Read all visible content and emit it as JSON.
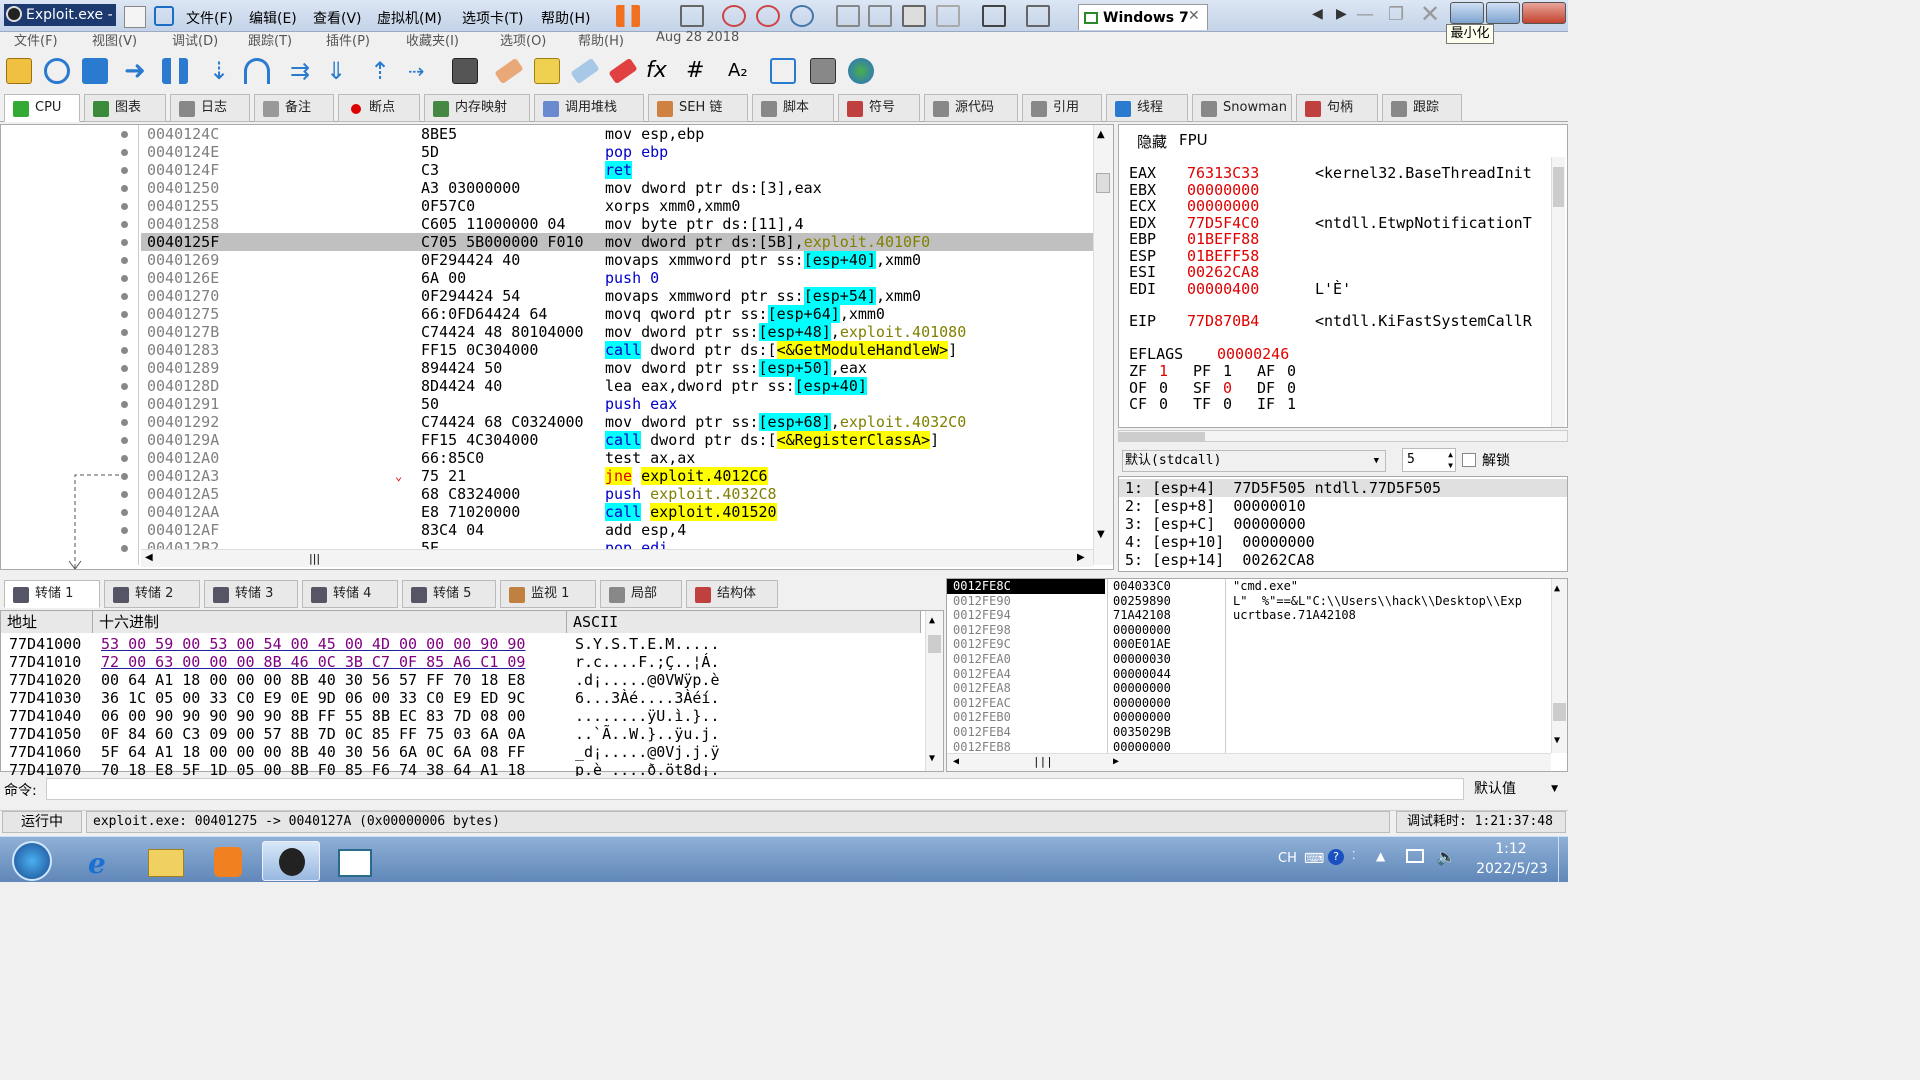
{
  "window": {
    "title": "Exploit.exe -",
    "vm_tab": "Windows 7",
    "tooltip": "最小化"
  },
  "host_menu": [
    "文件(F)",
    "编辑(E)",
    "查看(V)",
    "虚拟机(M)",
    "选项卡(T)",
    "帮助(H)"
  ],
  "app_menu": [
    "文件(F)",
    "视图(V)",
    "调试(D)",
    "跟踪(T)",
    "插件(P)",
    "收藏夹(I)",
    "选项(O)",
    "帮助(H)",
    "Aug 28 2018"
  ],
  "tabs": [
    "CPU",
    "图表",
    "日志",
    "备注",
    "断点",
    "内存映射",
    "调用堆栈",
    "SEH 链",
    "脚本",
    "符号",
    "源代码",
    "引用",
    "线程",
    "Snowman",
    "句柄",
    "跟踪"
  ],
  "disasm": [
    {
      "addr": "0040124C",
      "bytes": "8BE5",
      "ins": [
        [
          "mov esp,ebp",
          ""
        ]
      ]
    },
    {
      "addr": "0040124E",
      "bytes": "5D",
      "ins": [
        [
          "pop ebp",
          "blue"
        ]
      ]
    },
    {
      "addr": "0040124F",
      "bytes": "C3",
      "ins": [
        [
          "ret",
          "cyanblue"
        ]
      ]
    },
    {
      "addr": "00401250",
      "bytes": "A3 03000000",
      "ins": [
        [
          "mov dword ptr ",
          ""
        ],
        [
          "ds",
          ""
        ],
        [
          ":[3],eax",
          ""
        ]
      ]
    },
    {
      "addr": "00401255",
      "bytes": "0F57C0",
      "ins": [
        [
          "xorps xmm0,xmm0",
          ""
        ]
      ]
    },
    {
      "addr": "00401258",
      "bytes": "C605 11000000 04",
      "ins": [
        [
          "mov byte ptr ",
          ""
        ],
        [
          "ds",
          ""
        ],
        [
          ":[11],4",
          ""
        ]
      ]
    },
    {
      "addr": "0040125F",
      "bytes": "C705 5B000000 F010",
      "ins": [
        [
          "mov dword ptr ",
          ""
        ],
        [
          "ds",
          ""
        ],
        [
          ":[5B],",
          ""
        ],
        [
          "exploit.4010F0",
          "olive"
        ]
      ],
      "sel": true
    },
    {
      "addr": "00401269",
      "bytes": "0F294424 40",
      "ins": [
        [
          "movaps xmmword ptr ",
          ""
        ],
        [
          "ss",
          ""
        ],
        [
          ":",
          ""
        ],
        [
          "[esp+40]",
          "cyan"
        ],
        [
          ",xmm0",
          ""
        ]
      ]
    },
    {
      "addr": "0040126E",
      "bytes": "6A 00",
      "ins": [
        [
          "push 0",
          "blue"
        ]
      ]
    },
    {
      "addr": "00401270",
      "bytes": "0F294424 54",
      "ins": [
        [
          "movaps xmmword ptr ",
          ""
        ],
        [
          "ss",
          ""
        ],
        [
          ":",
          ""
        ],
        [
          "[esp+54]",
          "cyan"
        ],
        [
          ",xmm0",
          ""
        ]
      ]
    },
    {
      "addr": "00401275",
      "bytes": "66:0FD64424 64",
      "ins": [
        [
          "movq qword ptr ",
          ""
        ],
        [
          "ss",
          ""
        ],
        [
          ":",
          ""
        ],
        [
          "[esp+64]",
          "cyan"
        ],
        [
          ",xmm0",
          ""
        ]
      ]
    },
    {
      "addr": "0040127B",
      "bytes": "C74424 48 80104000",
      "ins": [
        [
          "mov dword ptr ",
          ""
        ],
        [
          "ss",
          ""
        ],
        [
          ":",
          ""
        ],
        [
          "[esp+48]",
          "cyan"
        ],
        [
          ",",
          ""
        ],
        [
          "exploit.401080",
          "olive"
        ]
      ]
    },
    {
      "addr": "00401283",
      "bytes": "FF15 0C304000",
      "ins": [
        [
          "call",
          "cyanblue"
        ],
        [
          " dword ptr ",
          ""
        ],
        [
          "ds",
          ""
        ],
        [
          ":[",
          ""
        ],
        [
          "<&GetModuleHandleW>",
          "yellow"
        ],
        [
          "]",
          ""
        ]
      ]
    },
    {
      "addr": "00401289",
      "bytes": "894424 50",
      "ins": [
        [
          "mov dword ptr ",
          ""
        ],
        [
          "ss",
          ""
        ],
        [
          ":",
          ""
        ],
        [
          "[esp+50]",
          "cyan"
        ],
        [
          ",eax",
          ""
        ]
      ]
    },
    {
      "addr": "0040128D",
      "bytes": "8D4424 40",
      "ins": [
        [
          "lea eax,dword ptr ",
          ""
        ],
        [
          "ss",
          ""
        ],
        [
          ":",
          ""
        ],
        [
          "[esp+40]",
          "cyan"
        ]
      ]
    },
    {
      "addr": "00401291",
      "bytes": "50",
      "ins": [
        [
          "push eax",
          "blue"
        ]
      ]
    },
    {
      "addr": "00401292",
      "bytes": "C74424 68 C0324000",
      "ins": [
        [
          "mov dword ptr ",
          ""
        ],
        [
          "ss",
          ""
        ],
        [
          ":",
          ""
        ],
        [
          "[esp+68]",
          "cyan"
        ],
        [
          ",",
          ""
        ],
        [
          "exploit.4032C0",
          "olive"
        ]
      ]
    },
    {
      "addr": "0040129A",
      "bytes": "FF15 4C304000",
      "ins": [
        [
          "call",
          "cyanblue"
        ],
        [
          " dword ptr ",
          ""
        ],
        [
          "ds",
          ""
        ],
        [
          ":[",
          ""
        ],
        [
          "<&RegisterClassA>",
          "yellow"
        ],
        [
          "]",
          ""
        ]
      ]
    },
    {
      "addr": "004012A0",
      "bytes": "66:85C0",
      "ins": [
        [
          "test ax,ax",
          ""
        ]
      ]
    },
    {
      "addr": "004012A3",
      "bytes": "75 21",
      "ins": [
        [
          "jne",
          "yellowred"
        ],
        [
          " ",
          ""
        ],
        [
          "exploit.4012C6",
          "yellow"
        ]
      ],
      "arrow": true
    },
    {
      "addr": "004012A5",
      "bytes": "68 C8324000",
      "ins": [
        [
          "push ",
          "blue"
        ],
        [
          "exploit.4032C8",
          "olive"
        ]
      ]
    },
    {
      "addr": "004012AA",
      "bytes": "E8 71020000",
      "ins": [
        [
          "call",
          "cyanblue"
        ],
        [
          " ",
          ""
        ],
        [
          "exploit.401520",
          "yellow"
        ]
      ]
    },
    {
      "addr": "004012AF",
      "bytes": "83C4 04",
      "ins": [
        [
          "add esp,4",
          ""
        ]
      ]
    },
    {
      "addr": "004012B2",
      "bytes": "5E",
      "ins": [
        [
          "pop edi",
          "blue"
        ]
      ]
    }
  ],
  "registers": {
    "header": [
      "隐藏",
      "FPU"
    ],
    "gp": [
      {
        "name": "EAX",
        "val": "76313C33",
        "cmt": "<kernel32.BaseThreadInit"
      },
      {
        "name": "EBX",
        "val": "00000000",
        "cmt": ""
      },
      {
        "name": "ECX",
        "val": "00000000",
        "cmt": ""
      },
      {
        "name": "EDX",
        "val": "77D5F4C0",
        "cmt": "<ntdll.EtwpNotificationT"
      },
      {
        "name": "EBP",
        "val": "01BEFF88",
        "cmt": ""
      },
      {
        "name": "ESP",
        "val": "01BEFF58",
        "cmt": ""
      },
      {
        "name": "ESI",
        "val": "00262CA8",
        "cmt": ""
      },
      {
        "name": "EDI",
        "val": "00000400",
        "cmt": "L'È'"
      }
    ],
    "eip": {
      "name": "EIP",
      "val": "77D870B4",
      "cmt": "<ntdll.KiFastSystemCallR"
    },
    "eflags": {
      "name": "EFLAGS",
      "val": "00000246"
    },
    "flags": [
      [
        [
          "ZF",
          "1"
        ],
        [
          "PF",
          "1"
        ],
        [
          "AF",
          "0"
        ]
      ],
      [
        [
          "OF",
          "0"
        ],
        [
          "SF",
          "0"
        ],
        [
          "DF",
          "0"
        ]
      ],
      [
        [
          "CF",
          "0"
        ],
        [
          "TF",
          "0"
        ],
        [
          "IF",
          "1"
        ]
      ]
    ]
  },
  "callconv": {
    "select": "默认(stdcall)",
    "count": "5",
    "unlock": "解锁"
  },
  "callstack": [
    "1: [esp+4]  77D5F505 ntdll.77D5F505",
    "2: [esp+8]  00000010",
    "3: [esp+C]  00000000",
    "4: [esp+10]  00000000",
    "5: [esp+14]  00262CA8"
  ],
  "dump_tabs": [
    "转储 1",
    "转储 2",
    "转储 3",
    "转储 4",
    "转储 5",
    "监视 1",
    "局部",
    "结构体"
  ],
  "dump_headers": [
    "地址",
    "十六进制",
    "ASCII"
  ],
  "dump": [
    {
      "addr": "77D41000",
      "hex": "53 00 59 00 53 00 54 00 45 00 4D 00 00 00 90 90",
      "ascii": "S.Y.S.T.E.M....."
    },
    {
      "addr": "77D41010",
      "hex": "72 00 63 00 00 00 8B 46 0C 3B C7 0F 85 A6 C1 09",
      "ascii": "r.c....F.;Ç..¦Á."
    },
    {
      "addr": "77D41020",
      "hex": "00 64 A1 18 00 00 00 8B 40 30 56 57 FF 70 18 E8",
      "ascii": ".d¡.....@0VWÿp.è"
    },
    {
      "addr": "77D41030",
      "hex": "36 1C 05 00 33 C0 E9 0E 9D 06 00 33 C0 E9 ED 9C",
      "ascii": "6...3Àé....3Àéí."
    },
    {
      "addr": "77D41040",
      "hex": "06 00 90 90 90 90 90 8B FF 55 8B EC 83 7D 08 00",
      "ascii": "........ÿU.ì.}.."
    },
    {
      "addr": "77D41050",
      "hex": "0F 84 60 C3 09 00 57 8B 7D 0C 85 FF 75 03 6A 0A",
      "ascii": "..`Ã..W.}..ÿu.j."
    },
    {
      "addr": "77D41060",
      "hex": "5F 64 A1 18 00 00 00 8B 40 30 56 6A 0C 6A 08 FF",
      "ascii": "_d¡.....@0Vj.j.ÿ"
    },
    {
      "addr": "77D41070",
      "hex": "70 18 E8 5F 1D 05 00 8B F0 85 F6 74 38 64 A1 18",
      "ascii": "p.è_....ð.öt8d¡."
    }
  ],
  "stack": [
    {
      "addr": "0012FE8C",
      "val": "004033C0",
      "cmt": "\"cmd.exe\""
    },
    {
      "addr": "0012FE90",
      "val": "00259890",
      "cmt": "L\"  %\"==&L\"C:\\\\Users\\\\hack\\\\Desktop\\\\Exp"
    },
    {
      "addr": "0012FE94",
      "val": "71A42108",
      "cmt": "ucrtbase.71A42108"
    },
    {
      "addr": "0012FE98",
      "val": "00000000",
      "cmt": ""
    },
    {
      "addr": "0012FE9C",
      "val": "000E01AE",
      "cmt": ""
    },
    {
      "addr": "0012FEA0",
      "val": "00000030",
      "cmt": ""
    },
    {
      "addr": "0012FEA4",
      "val": "00000044",
      "cmt": ""
    },
    {
      "addr": "0012FEA8",
      "val": "00000000",
      "cmt": ""
    },
    {
      "addr": "0012FEAC",
      "val": "00000000",
      "cmt": ""
    },
    {
      "addr": "0012FEB0",
      "val": "00000000",
      "cmt": ""
    },
    {
      "addr": "0012FEB4",
      "val": "0035029B",
      "cmt": ""
    },
    {
      "addr": "0012FEB8",
      "val": "00000000",
      "cmt": ""
    }
  ],
  "command": {
    "label": "命令:",
    "value": "",
    "default": "默认值"
  },
  "status": {
    "state": "运行中",
    "msg": "exploit.exe: 00401275 -> 0040127A (0x00000006 bytes)",
    "time": "调试耗时: 1:21:37:48"
  },
  "taskbar": {
    "lang": "CH",
    "time": "1:12",
    "date": "2022/5/23"
  }
}
